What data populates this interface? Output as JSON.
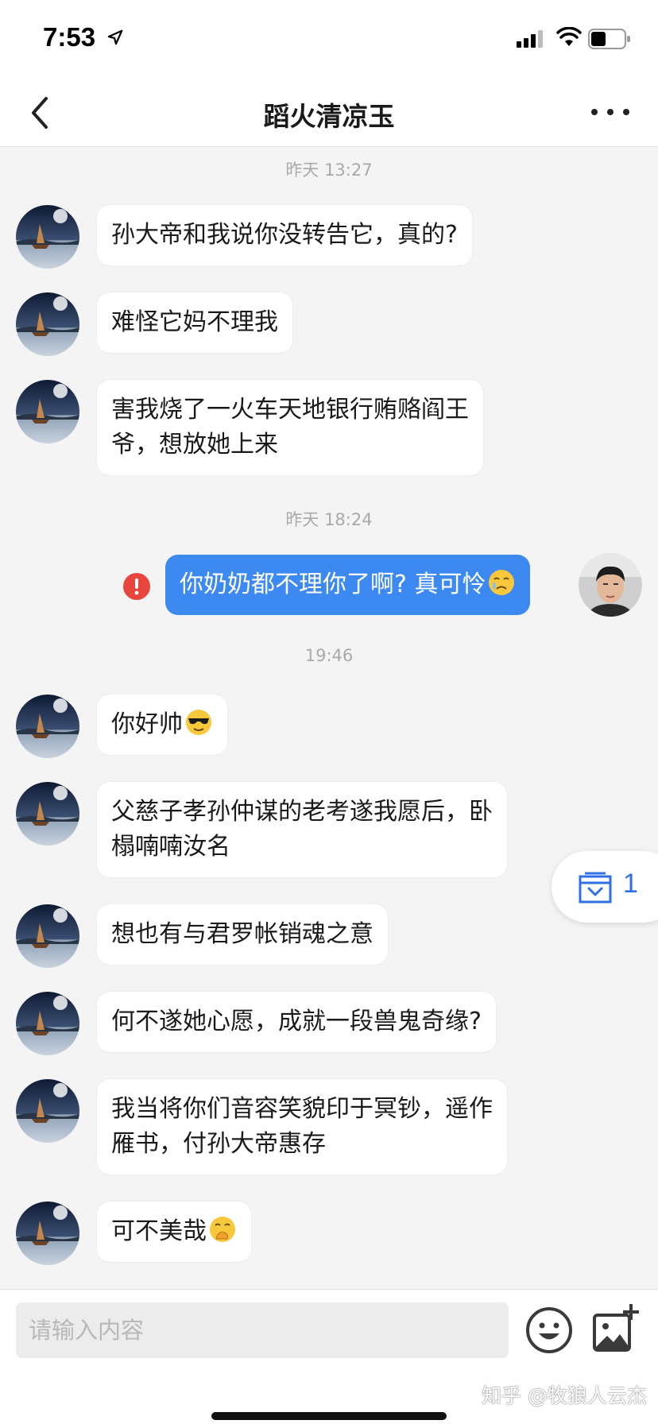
{
  "status_bar": {
    "time": "7:53",
    "icons": [
      "location-arrow-icon",
      "signal-icon",
      "wifi-icon",
      "battery-icon"
    ]
  },
  "nav": {
    "title": "蹈火清凉玉",
    "back_icon": "chevron-left-icon",
    "more_icon": "more-dots-icon"
  },
  "timestamps": [
    "昨天 13:27",
    "昨天 18:24",
    "19:46"
  ],
  "messages": [
    {
      "sender": "other",
      "lines": [
        "孙大帝和我说你没转告它，真的?"
      ]
    },
    {
      "sender": "other",
      "lines": [
        "难怪它妈不理我"
      ]
    },
    {
      "sender": "other",
      "lines": [
        "害我烧了一火车天地银行贿赂阎王",
        "爷，想放她上来"
      ]
    },
    {
      "sender": "me",
      "lines": [
        "你奶奶都不理你了啊? 真可怜"
      ],
      "emoji": "crying-face-emoji",
      "failed": true
    },
    {
      "sender": "other",
      "lines": [
        "你好帅"
      ],
      "emoji": "sunglasses-face-emoji"
    },
    {
      "sender": "other",
      "lines": [
        "父慈子孝孙仲谋的老考遂我愿后，卧",
        "榻喃喃汝名"
      ]
    },
    {
      "sender": "other",
      "lines": [
        "想也有与君罗帐销魂之意"
      ]
    },
    {
      "sender": "other",
      "lines": [
        "何不遂她心愿，成就一段兽鬼奇缘?"
      ]
    },
    {
      "sender": "other",
      "lines": [
        "我当将你们音容笑貌印于冥钞，遥作",
        "雁书，付孙大帝惠存"
      ]
    },
    {
      "sender": "other",
      "lines": [
        "可不美哉"
      ],
      "emoji": "hand-over-mouth-emoji"
    }
  ],
  "unread_tab": {
    "count": "1",
    "icon": "inbox-down-icon"
  },
  "input": {
    "placeholder": "请输入内容",
    "value": ""
  },
  "watermark": "知乎 @牧狼人云杰",
  "colors": {
    "outgoing_bubble": "#3c89f1",
    "error": "#e8453c",
    "accent": "#2f6fe4"
  }
}
